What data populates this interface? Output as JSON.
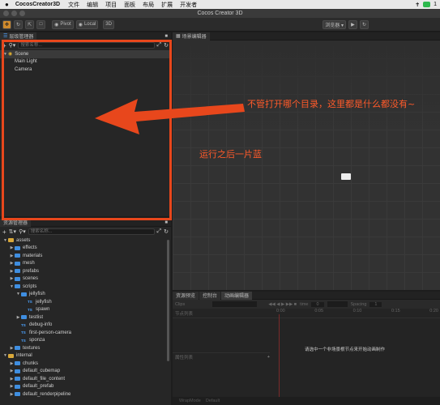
{
  "menubar": {
    "app_name": "CocosCreator3D",
    "items": [
      "文件",
      "编辑",
      "项目",
      "面板",
      "布局",
      "扩展",
      "开发者"
    ]
  },
  "window": {
    "title": "Cocos Creator 3D"
  },
  "toolbar": {
    "pivot_label": "Pivot",
    "local_label": "Local",
    "mode_label": "3D",
    "browser_label": "浏览器 ▾"
  },
  "hierarchy": {
    "tab_label": "层级管理器",
    "search_placeholder": "搜索名称...",
    "items": [
      {
        "label": "Scene",
        "depth": 0
      },
      {
        "label": "Main Light",
        "depth": 1
      },
      {
        "label": "Camera",
        "depth": 1
      }
    ]
  },
  "assets": {
    "tab_label": "资源管理器",
    "search_placeholder": "搜索名称...",
    "items": [
      {
        "label": "assets",
        "depth": 0,
        "kind": "db",
        "open": true
      },
      {
        "label": "effects",
        "depth": 1,
        "kind": "folder",
        "open": false
      },
      {
        "label": "materials",
        "depth": 1,
        "kind": "folder",
        "open": false
      },
      {
        "label": "mesh",
        "depth": 1,
        "kind": "folder",
        "open": false
      },
      {
        "label": "prefabs",
        "depth": 1,
        "kind": "folder",
        "open": false
      },
      {
        "label": "scenes",
        "depth": 1,
        "kind": "folder",
        "open": false
      },
      {
        "label": "scripts",
        "depth": 1,
        "kind": "folder",
        "open": true
      },
      {
        "label": "jellyfish",
        "depth": 2,
        "kind": "folder",
        "open": true
      },
      {
        "label": "jellyfish",
        "depth": 3,
        "kind": "ts"
      },
      {
        "label": "spawn",
        "depth": 3,
        "kind": "ts"
      },
      {
        "label": "testlist",
        "depth": 2,
        "kind": "folder",
        "open": false
      },
      {
        "label": "debug-info",
        "depth": 2,
        "kind": "ts"
      },
      {
        "label": "first-person-camera",
        "depth": 2,
        "kind": "ts"
      },
      {
        "label": "sponza",
        "depth": 2,
        "kind": "ts"
      },
      {
        "label": "textures",
        "depth": 1,
        "kind": "folder",
        "open": false
      },
      {
        "label": "internal",
        "depth": 0,
        "kind": "db",
        "open": true
      },
      {
        "label": "chunks",
        "depth": 1,
        "kind": "folder",
        "open": false
      },
      {
        "label": "default_cubemap",
        "depth": 1,
        "kind": "folder",
        "open": false
      },
      {
        "label": "default_file_content",
        "depth": 1,
        "kind": "folder",
        "open": false
      },
      {
        "label": "default_prefab",
        "depth": 1,
        "kind": "folder",
        "open": false
      },
      {
        "label": "default_renderpipeline",
        "depth": 1,
        "kind": "folder",
        "open": false
      }
    ]
  },
  "scene_editor": {
    "tab_label": "场景编辑器"
  },
  "bottom": {
    "tabs": [
      "资源预览",
      "控制台",
      "动画编辑器"
    ],
    "clips_label": "Clips",
    "time_label": "time",
    "time_value": "0",
    "spacing_label": "Spacing",
    "spacing_value": "1",
    "node_list_label": "节点列表",
    "prop_list_label": "属性列表",
    "ruler": [
      "0:00",
      "0:05",
      "0:10",
      "0:15",
      "0:20"
    ],
    "message": "请选中一个非场景根节点来开始动画制作",
    "wrap_label": "WrapMode",
    "wrap_value": "Default"
  },
  "annotations": {
    "main": "不管打开哪个目录，这里都是什么都没有~",
    "second": "运行之后一片蓝"
  },
  "colors": {
    "annotation": "#e8471c",
    "accent": "#d08a2c",
    "folder": "#3f8ee0"
  }
}
